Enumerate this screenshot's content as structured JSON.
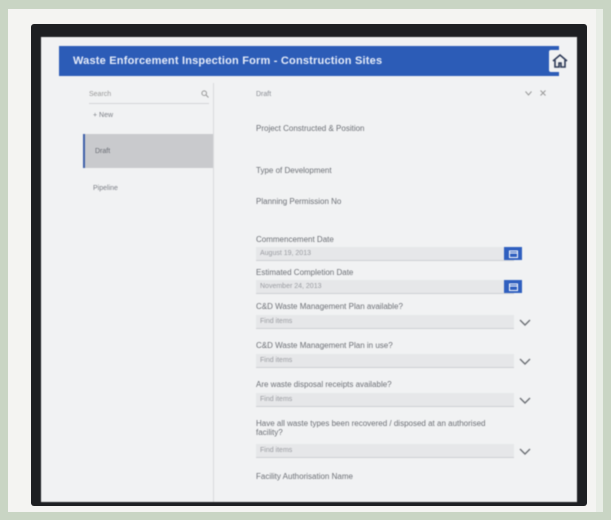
{
  "app": {
    "title": "Waste Enforcement Inspection Form - Construction Sites"
  },
  "sidebar": {
    "search_placeholder": "Search",
    "items": [
      {
        "label": "+ New"
      },
      {
        "label": "Draft"
      },
      {
        "label": "Pipeline"
      }
    ]
  },
  "content": {
    "header_label": "Draft",
    "fields": [
      {
        "label": "Project Constructed & Position"
      },
      {
        "label": "Type of Development"
      },
      {
        "label": "Planning Permission No"
      },
      {
        "label": "Commencement Date",
        "value": "August 19, 2013",
        "control": "calendar"
      },
      {
        "label": "Estimated Completion Date",
        "value": "November 24, 2013",
        "control": "calendar"
      },
      {
        "label": "C&D Waste Management Plan available?",
        "value": "Find items",
        "control": "dropdown"
      },
      {
        "label": "C&D Waste Management Plan in use?",
        "value": "Find items",
        "control": "dropdown"
      },
      {
        "label": "Are waste disposal receipts available?",
        "value": "Find items",
        "control": "dropdown"
      },
      {
        "label": "Have all waste types been recovered / disposed at an authorised facility?",
        "value": "Find items",
        "control": "dropdown"
      },
      {
        "label": "Facility Authorisation Name"
      }
    ]
  },
  "colors": {
    "accent": "#2c5cb7",
    "background": "#f1f2f3"
  }
}
